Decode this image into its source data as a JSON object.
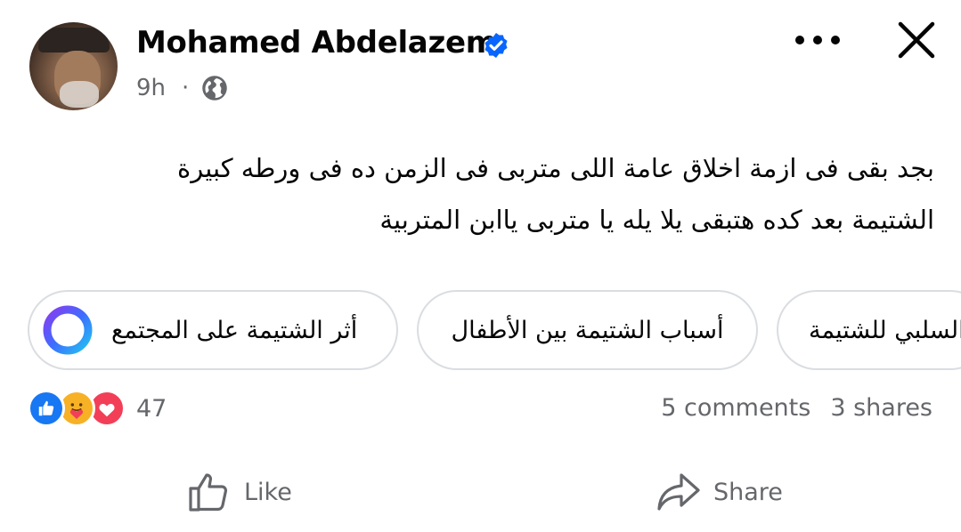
{
  "author": {
    "name": "Mohamed Abdelazem",
    "time": "9h",
    "separator": "·"
  },
  "post": {
    "lines": [
      "بجد بقى فى ازمة اخلاق عامة اللى متربى فى الزمن  ده فى ورطه كبيرة",
      "الشتيمة بعد كده هتبقى يلا يله يا متربى ياابن المتربية"
    ]
  },
  "suggestions": [
    "أثر الشتيمة على المجتمع",
    "أسباب الشتيمة بين الأطفال",
    "السلبي للشتيمة"
  ],
  "reactions": {
    "count": "47",
    "types": [
      "like",
      "care",
      "love"
    ]
  },
  "stats": {
    "comments": "5 comments",
    "shares": "3 shares"
  },
  "actions": {
    "like": "Like",
    "share": "Share"
  },
  "colors": {
    "verified": "#0866ff",
    "like": "#1877f2",
    "love": "#f33e58",
    "care": "#f7b125",
    "muted": "#65676b"
  }
}
